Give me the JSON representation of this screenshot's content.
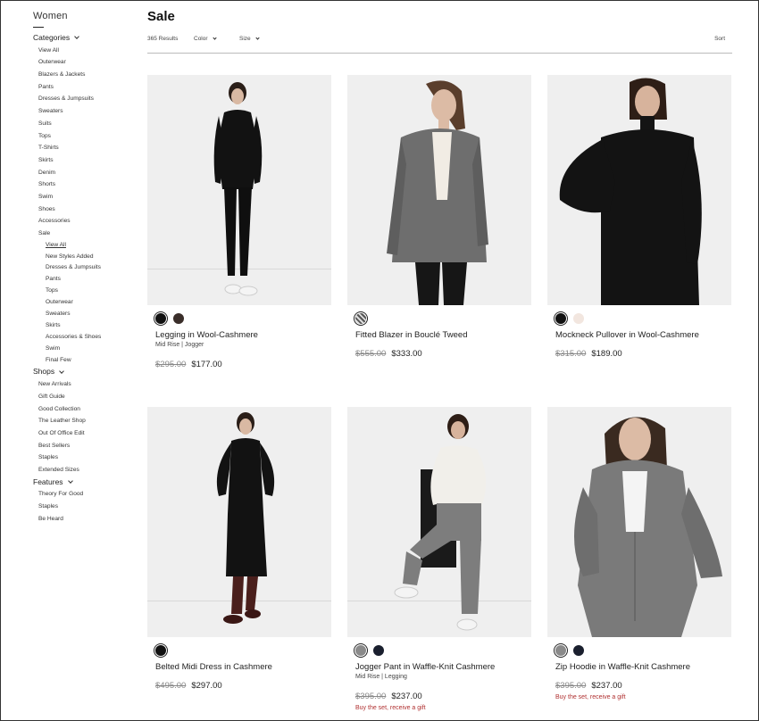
{
  "sidebar": {
    "title": "Women",
    "groups": {
      "categories": {
        "label": "Categories",
        "items": [
          "View All",
          "Outerwear",
          "Blazers & Jackets",
          "Pants",
          "Dresses & Jumpsuits",
          "Sweaters",
          "Suits",
          "Tops",
          "T-Shirts",
          "Skirts",
          "Denim",
          "Shorts",
          "Swim",
          "Shoes",
          "Accessories",
          "Sale"
        ]
      },
      "sale_sub": [
        "View All",
        "New Styles Added",
        "Dresses & Jumpsuits",
        "Pants",
        "Tops",
        "Outerwear",
        "Sweaters",
        "Skirts",
        "Accessories & Shoes",
        "Swim",
        "Final Few"
      ],
      "shops": {
        "label": "Shops",
        "items": [
          "New Arrivals",
          "Gift Guide",
          "Good Collection",
          "The Leather Shop",
          "Out Of Office Edit",
          "Best Sellers",
          "Staples",
          "Extended Sizes"
        ]
      },
      "features": {
        "label": "Features",
        "items": [
          "Theory For Good",
          "Staples",
          "Be Heard"
        ]
      }
    }
  },
  "header": {
    "title": "Sale",
    "results": "365 Results",
    "color_filter": "Color",
    "size_filter": "Size",
    "sort": "Sort"
  },
  "products": [
    {
      "name": "Legging in Wool-Cashmere",
      "sub": "Mid Rise | Jogger",
      "old_price": "$295.00",
      "price": "$177.00",
      "promo": "",
      "swatches": [
        "#111111",
        "#3a2e2a"
      ]
    },
    {
      "name": "Fitted Blazer in Bouclé Tweed",
      "sub": "",
      "old_price": "$555.00",
      "price": "$333.00",
      "promo": "",
      "swatches": [
        "#777777"
      ]
    },
    {
      "name": "Mockneck Pullover in Wool-Cashmere",
      "sub": "",
      "old_price": "$315.00",
      "price": "$189.00",
      "promo": "",
      "swatches": [
        "#111111",
        "#f2e6df"
      ]
    },
    {
      "name": "Belted Midi Dress in Cashmere",
      "sub": "",
      "old_price": "$495.00",
      "price": "$297.00",
      "promo": "",
      "swatches": [
        "#111111"
      ]
    },
    {
      "name": "Jogger Pant in Waffle-Knit Cashmere",
      "sub": "Mid Rise | Legging",
      "old_price": "$395.00",
      "price": "$237.00",
      "promo": "Buy the set, receive a gift",
      "swatches": [
        "#8a8a8a",
        "#1a1f2e"
      ]
    },
    {
      "name": "Zip Hoodie in Waffle-Knit Cashmere",
      "sub": "",
      "old_price": "$395.00",
      "price": "$237.00",
      "promo": "Buy the set, receive a gift",
      "swatches": [
        "#8a8a8a",
        "#1a1f2e"
      ]
    }
  ]
}
